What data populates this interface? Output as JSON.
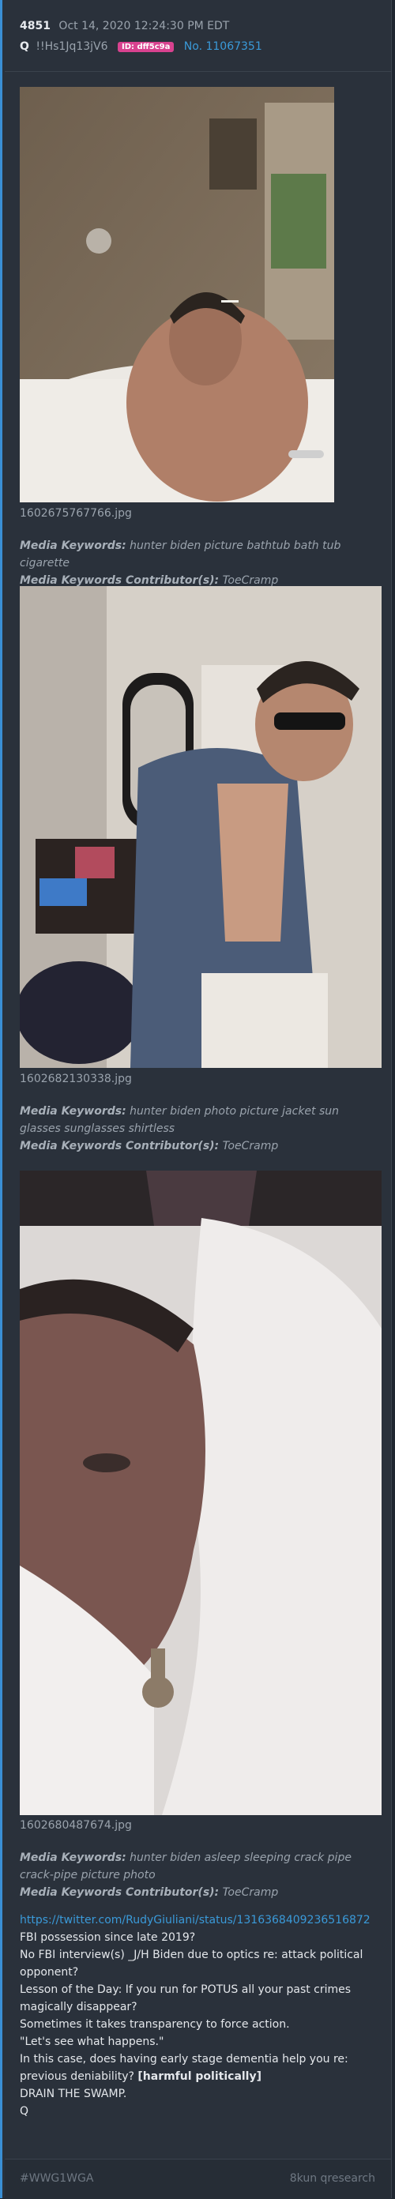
{
  "post": {
    "number": "4851",
    "date": "Oct 14, 2020 12:24:30 PM EDT",
    "author": "Q",
    "tripcode": "!!Hs1Jq13jV6",
    "id_badge": "ID: dff5c9a",
    "post_link": "No. 11067351"
  },
  "images": [
    {
      "filename": "1602675767766.jpg",
      "keywords_label": "Media Keywords:",
      "keywords": " hunter biden picture bathtub bath tub cigarette",
      "contributor_label": "Media Keywords Contributor(s):",
      "contributor": " ToeCramp"
    },
    {
      "filename": "1602682130338.jpg",
      "keywords_label": "Media Keywords:",
      "keywords": " hunter biden photo picture jacket sun glasses sunglasses shirtless",
      "contributor_label": "Media Keywords Contributor(s):",
      "contributor": " ToeCramp"
    },
    {
      "filename": "1602680487674.jpg",
      "keywords_label": "Media Keywords:",
      "keywords": " hunter biden asleep sleeping crack pipe crack-pipe picture photo",
      "contributor_label": "Media Keywords Contributor(s):",
      "contributor": " ToeCramp"
    }
  ],
  "body": {
    "link": "https://twitter.com/RudyGiuliani/status/1316368409236516872",
    "lines": [
      "FBI possession since late 2019?",
      "No FBI interview(s) _J/H Biden due to optics re: attack political opponent?",
      "Lesson of the Day: If you run for POTUS all your past crimes magically disappear?",
      "Sometimes it takes transparency to force action.",
      "\"Let's see what happens.\"",
      "In this case, does having early stage dementia help you re: previous deniability?",
      "[harmful politically]",
      "DRAIN THE SWAMP.",
      "Q"
    ]
  },
  "footer": {
    "tag": "#WWG1WGA",
    "source": "8kun qresearch"
  }
}
